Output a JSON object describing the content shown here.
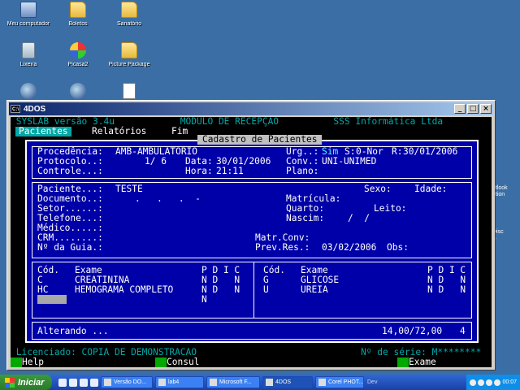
{
  "desktop": {
    "icons": [
      {
        "label": "Meu computador",
        "icon": "computer-icon"
      },
      {
        "label": "Boletos",
        "icon": "folder-icon"
      },
      {
        "label": "Sanatório",
        "icon": "folder-icon"
      },
      {
        "label": "Lixeira",
        "icon": "recycle-bin-icon"
      },
      {
        "label": "Picasa2",
        "icon": "picasa-icon"
      },
      {
        "label": "Picture Package",
        "icon": "folder-icon"
      }
    ],
    "side_text": {
      "a": "utlook",
      "b": "ation",
      "c": "Disc",
      "d": "S"
    }
  },
  "window": {
    "title": "4DOS",
    "app_icon": "C:\\",
    "buttons": {
      "minimize": "_",
      "maximize": "□",
      "close": "×"
    }
  },
  "app": {
    "top_line": " SYSLAB versão 3.4u            MODULO DE RECEPÇÃO          SSS Informática Ltda",
    "menu": [
      "Pacientes",
      "Relatórios",
      "Fim"
    ],
    "dialog_title": "Cadastro de Pacientes",
    "header": {
      "procedencia_label": "Procedência:",
      "procedencia_value": "AMB-AMBULATORIO",
      "protocolo_label": "Protocolo..:",
      "protocolo_value": "1/ 6",
      "controle_label": "Controle...:",
      "urg_label": "Urg..:",
      "urg_value": "Sim",
      "s_label": "S:",
      "s_value": "0-Nor",
      "r_label": "R:",
      "r_value": "30/01/2006",
      "data_label": "Data:",
      "data_value": "30/01/2006",
      "hora_label": "Hora:",
      "hora_value": "21:11",
      "conv_label": "Conv.:",
      "conv_value": "UNI-UNIMED",
      "plano_label": "Plano:"
    },
    "patient": {
      "paciente_label": "Paciente...:",
      "paciente_value": "TESTE",
      "documento_label": "Documento..:",
      "documento_mask": ".   .   .  -",
      "setor_label": "Setor......:",
      "telefone_label": "Telefone...:",
      "medico_label": "Médico.....:",
      "crm_label": "CRM........:",
      "guia_label": "Nº da Guia.:",
      "sexo_label": "Sexo:",
      "idade_label": "Idade:",
      "matricula_label": "Matrícula:",
      "quarto_label": "Quarto:",
      "leito_label": "Leito:",
      "nascim_label": "Nascim:",
      "nascim_mask": "/  /",
      "matr_conv_label": "Matr.Conv:",
      "prev_res_label": "Prev.Res.:",
      "prev_res_value": "03/02/2006",
      "obs_label": "Obs:"
    },
    "exams_header": {
      "cod": "Cód.",
      "exame": "Exame",
      "flags": "P D I C"
    },
    "exams_left": [
      {
        "cod": "C",
        "exame": "CREATININA",
        "flags": "N D   N"
      },
      {
        "cod": "HC",
        "exame": "HEMOGRAMA COMPLETO",
        "flags": "N D   N"
      },
      {
        "cod": "",
        "exame": "",
        "flags": "N"
      }
    ],
    "exams_right": [
      {
        "cod": "G",
        "exame": "GLICOSE",
        "flags": "N D   N"
      },
      {
        "cod": "U",
        "exame": "UREIA",
        "flags": "N D   N"
      }
    ],
    "footer": {
      "status": "Alterando ...",
      "totals": "14,00/72,00",
      "count": "4"
    },
    "status_line": " Licenciado: COPIA DE DEMONSTRACAO                              Nº de série: M********",
    "help": [
      {
        "key": "F1",
        "label": "Help"
      },
      {
        "key": "F2",
        "label": "Consul"
      },
      {
        "key": "F10",
        "label": "Exame"
      }
    ]
  },
  "taskbar": {
    "start": "Iniciar",
    "tasks": [
      "Versão DO...",
      "lab4",
      "Microsoft F...",
      "4DOS",
      "Corel PHOT..."
    ],
    "dev": "Dev",
    "clock": "00:07"
  }
}
